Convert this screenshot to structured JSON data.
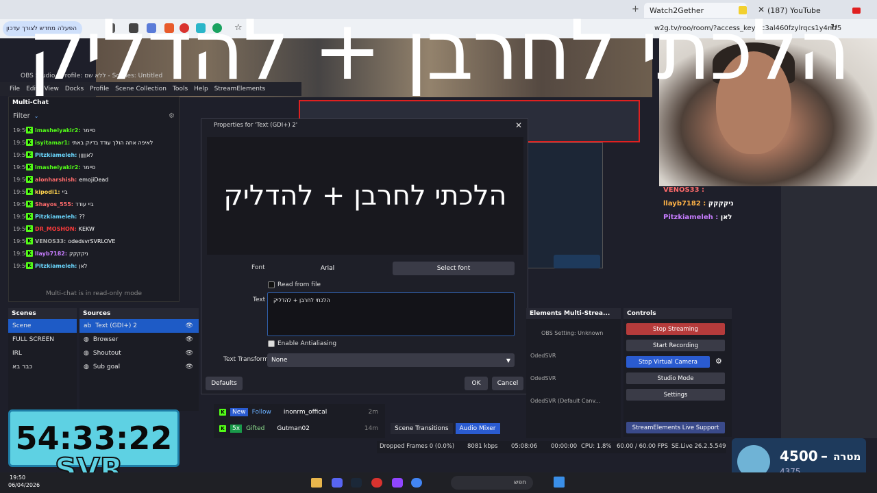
{
  "browser": {
    "tabs": [
      {
        "label": "Watch2Gether"
      },
      {
        "label": "(187) YouTube"
      }
    ],
    "update_pill": "הפעלה מחדש לצורך עדכון",
    "url": "w2g.tv/roo/room/?access_key=c3al460fzylrqcs1y4nrf5"
  },
  "overlay_title": "הלכתי לחרבן + להדליק",
  "obs": {
    "window_title": "OBS Studio - Profile: ללא שם - Scenes: Untitled",
    "menu": [
      "File",
      "Edit",
      "View",
      "Docks",
      "Profile",
      "Scene Collection",
      "Tools",
      "Help",
      "StreamElements"
    ],
    "multichat": {
      "title": "Multi-Chat",
      "filter": "Filter",
      "footer": "Multi-chat is in read-only mode",
      "messages": [
        {
          "time": "19:50",
          "user": "imashelyakir2:",
          "text": "סיימר",
          "color": "#53fc18"
        },
        {
          "time": "19:50",
          "user": "isyitamar1:",
          "text": "לאיפה אתה הולך עודד בדיוק באתי",
          "color": "#53fc18"
        },
        {
          "time": "19:50",
          "user": "Pitzkiameleh:",
          "text": "לאןןןןן",
          "color": "#6bd8ff"
        },
        {
          "time": "19:50",
          "user": "imashelyakir2:",
          "text": "סיימר",
          "color": "#53fc18"
        },
        {
          "time": "19:50",
          "user": "alonharshish:",
          "text": "emojiDead",
          "color": "#ff6b6b"
        },
        {
          "time": "19:50",
          "user": "kipodi1:",
          "text": "ביי",
          "color": "#ffd34d"
        },
        {
          "time": "19:50",
          "user": "Shayos_555:",
          "text": "ביי עודד",
          "color": "#ff6b6b"
        },
        {
          "time": "19:50",
          "user": "Pitzkiameleh:",
          "text": "??",
          "color": "#6bd8ff"
        },
        {
          "time": "19:50",
          "user": "DR_MOSHON:",
          "text": "KEKW",
          "color": "#ff3b3b"
        },
        {
          "time": "19:50",
          "user": "VENOS33:",
          "text": "odedsvrSVRLOVE",
          "color": "#aaaaaa"
        },
        {
          "time": "19:50",
          "user": "llayb7182:",
          "text": "ניקקקק",
          "color": "#c77dff"
        },
        {
          "time": "19:50",
          "user": "Pitzkiameleh:",
          "text": "לאן",
          "color": "#6bd8ff"
        }
      ]
    },
    "scenes": {
      "title": "Scenes",
      "items": [
        "Scene",
        "FULL SCREEN",
        "IRL",
        "כבר בא"
      ]
    },
    "sources": {
      "title": "Sources",
      "items": [
        "Text (GDI+) 2",
        "Browser",
        "Shoutout",
        "Sub goal"
      ]
    },
    "dialog": {
      "title": "Properties for 'Text (GDI+) 2'",
      "preview_text": "הלכתי לחרבן + להדליק",
      "font_label": "Font",
      "font_value": "Arial",
      "select_font": "Select font",
      "read_from_file": "Read from file",
      "text_label": "Text",
      "text_value": "הלכתי לחרבן + להדליק",
      "antialias": "Enable Antialiasing",
      "transform_label": "Text Transform",
      "transform_value": "None",
      "defaults": "Defaults",
      "ok": "OK",
      "cancel": "Cancel"
    },
    "multistream": {
      "title": "Elements Multi-Strea...",
      "setting": "OBS Setting: Unknown",
      "entries": [
        "OdedSVR",
        "OdedSVR",
        "OdedSVR (Default Canv..."
      ]
    },
    "controls": {
      "title": "Controls",
      "stop_streaming": "Stop Streaming",
      "start_recording": "Start Recording",
      "stop_virtual_camera": "Stop Virtual Camera",
      "studio_mode": "Studio Mode",
      "settings": "Settings",
      "support": "StreamElements Live Support"
    },
    "events": [
      {
        "badge": "New",
        "tag": "Follow",
        "user": "inonrm_offical",
        "time": "2m"
      },
      {
        "badge": "5x",
        "tag": "Gifted",
        "user": "Gutman02",
        "time": "14m"
      }
    ],
    "bottom_tabs": [
      "Scene Transitions",
      "Audio Mixer"
    ],
    "status": {
      "dropped": "Dropped Frames 0 (0.0%)",
      "bitrate": "8081 kbps",
      "live_time": "05:08:06",
      "rec_time": "00:00:00",
      "cpu": "CPU: 1.8%",
      "fps": "60.00 / 60.00 FPS",
      "version": "SE.Live 26.2.5.549"
    }
  },
  "overlay": {
    "timer": "54:33:22",
    "brand": "SVR",
    "goal_label": "מטרה",
    "goal_target": "4500",
    "goal_current": "4375",
    "chat_right": [
      {
        "user": "VENOS33 :",
        "color": "#ff6b6b"
      },
      {
        "user": "llayb7182 :",
        "color": "#ffb347",
        "text": "ניקקקק"
      },
      {
        "user": "Pitzkiameleh :",
        "color": "#c77dff",
        "text": "לאן"
      }
    ]
  },
  "taskbar": {
    "time": "19:50",
    "date": "06/04/2026",
    "search": "חפש"
  }
}
